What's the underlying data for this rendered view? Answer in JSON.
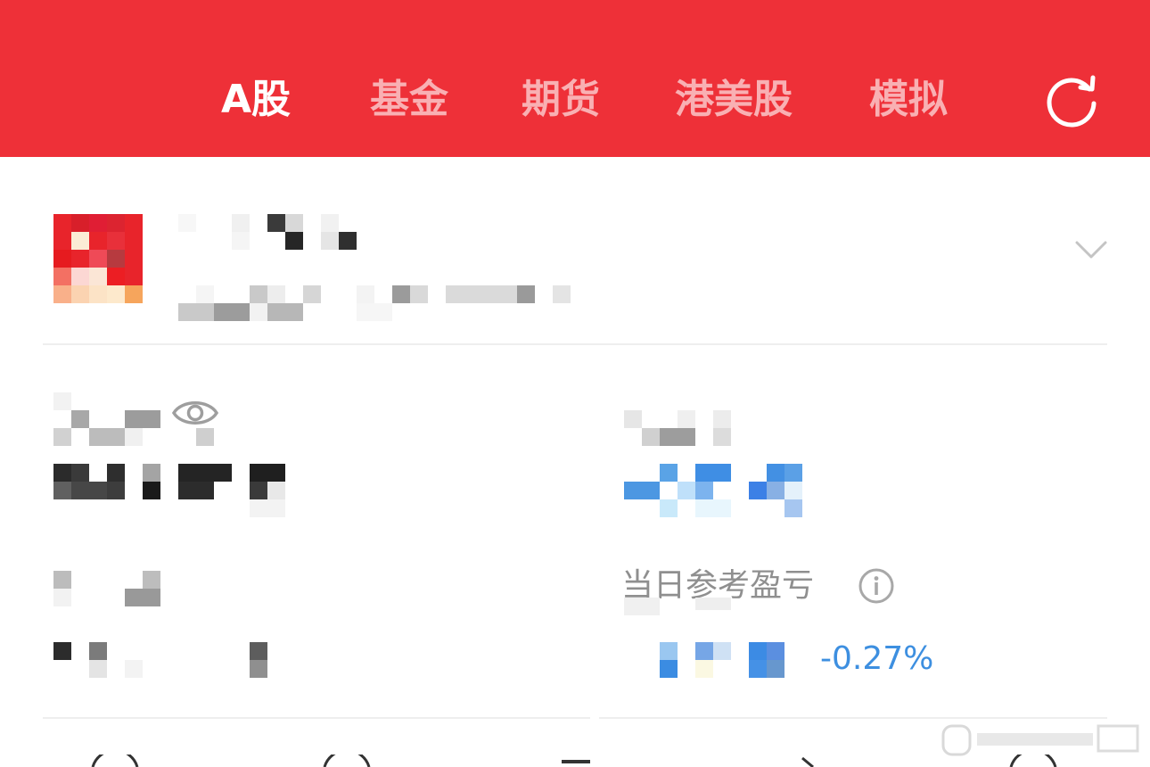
{
  "topbar": {
    "tabs": [
      {
        "label": "A股",
        "active": true
      },
      {
        "label": "基金",
        "active": false
      },
      {
        "label": "期货",
        "active": false
      },
      {
        "label": "港美股",
        "active": false
      },
      {
        "label": "模拟",
        "active": false
      }
    ],
    "refresh_icon": "refresh-icon",
    "background": "#ee3038"
  },
  "account": {
    "expand_icon": "chevron-down-icon"
  },
  "assets": {
    "visibility_icon": "eye-icon"
  },
  "daily": {
    "label": "当日参考盈亏",
    "info_icon": "info-icon",
    "percent": "-0.27%",
    "percent_color": "#3d8fe0"
  }
}
